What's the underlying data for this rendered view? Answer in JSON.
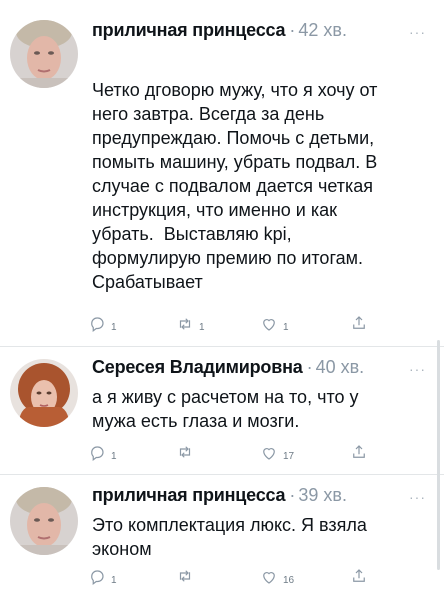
{
  "tweets": [
    {
      "author": "приличная принцесса",
      "separator": "·",
      "time": "42 хв.",
      "more": "···",
      "text": "Четко дговорю мужу, что я хочу от\nнего завтра. Всегда за день\nпредупреждаю. Помочь с детьми,\nпомыть машину, убрать подвал. В\nслучае с подвалом дается четкая\nинструкция, что именно и как\nубрать.  Выставляю kpi,\nформулирую премию по итогам.\nСрабатывает",
      "reply_count": "1",
      "retweet_count": "1",
      "like_count": "1"
    },
    {
      "author": "Сересея Владимировна",
      "separator": "·",
      "time": "40 хв.",
      "more": "···",
      "text": "а я живу с расчетом на то, что у\nмужа есть глаза и мозги.",
      "reply_count": "1",
      "retweet_count": "",
      "like_count": "17"
    },
    {
      "author": "приличная принцесса",
      "separator": "·",
      "time": "39 хв.",
      "more": "···",
      "text": "Это комплектация люкс. Я взяла\nэконом",
      "reply_count": "1",
      "retweet_count": "",
      "like_count": "16"
    }
  ],
  "icons": {
    "reply": "reply-icon",
    "retweet": "retweet-icon",
    "like": "heart-icon",
    "share": "share-icon"
  },
  "colors": {
    "text": "#0f1419",
    "muted": "#8b98a5",
    "divider": "#e3e6e8"
  }
}
